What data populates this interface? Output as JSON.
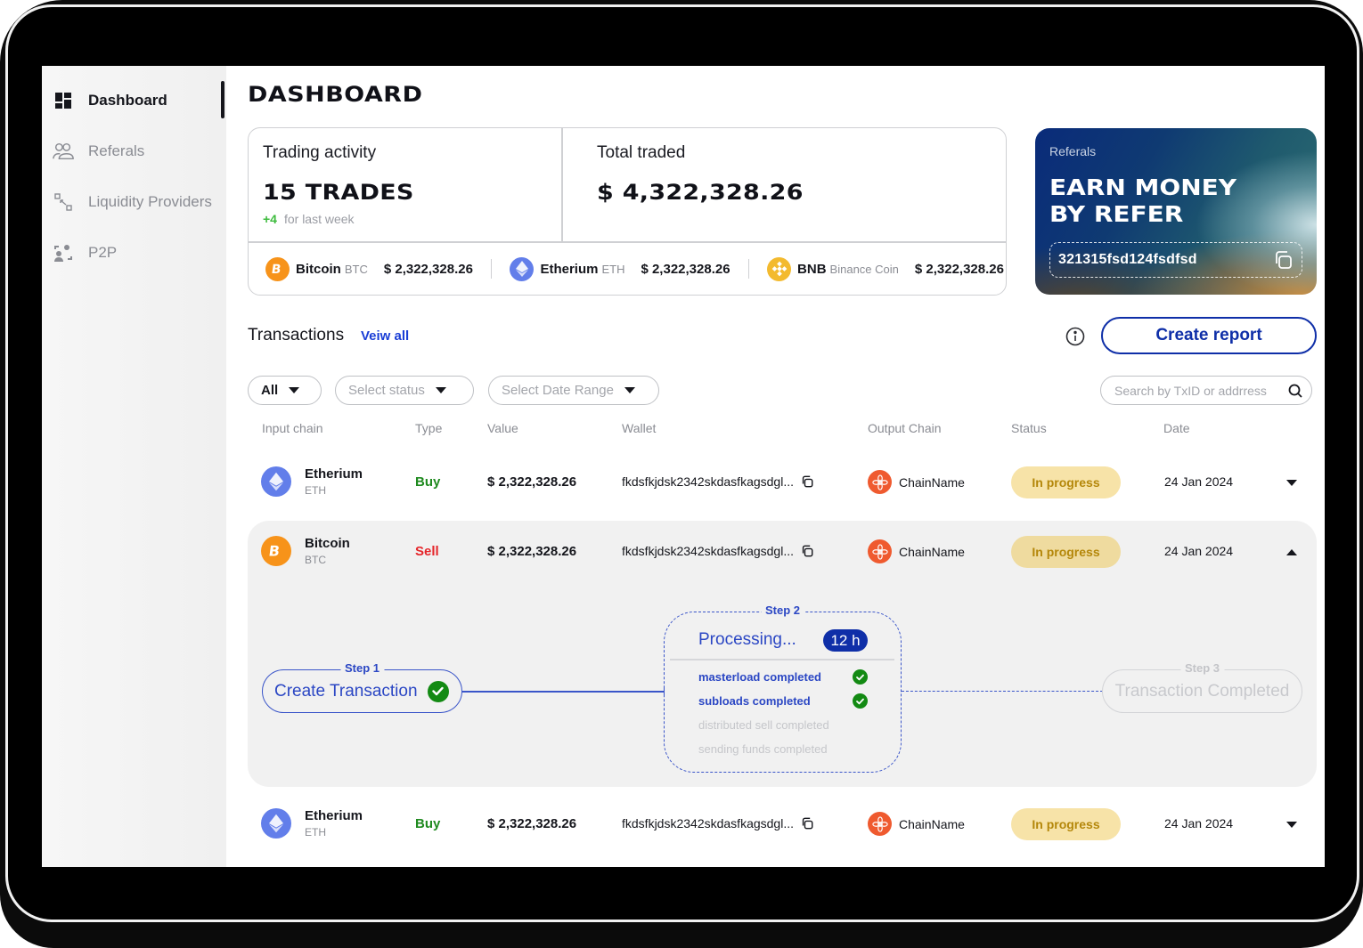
{
  "sidebar": {
    "items": [
      {
        "label": "Dashboard",
        "icon": "dashboard-grid-icon",
        "active": true
      },
      {
        "label": "Referals",
        "icon": "users-icon",
        "active": false
      },
      {
        "label": "Liquidity Providers",
        "icon": "nodes-icon",
        "active": false
      },
      {
        "label": "P2P",
        "icon": "p2p-exchange-icon",
        "active": false
      }
    ]
  },
  "header": {
    "title": "DASHBOARD"
  },
  "stats": {
    "trading_activity": {
      "label": "Trading activity",
      "value": "15 TRADES",
      "delta": "+4",
      "delta_caption": "for last week"
    },
    "total_traded": {
      "label": "Total traded",
      "value": "$ 4,322,328.26"
    },
    "coins": [
      {
        "name": "Bitcoin",
        "ticker": "BTC",
        "value": "$ 2,322,328.26",
        "icon": "bitcoin-icon",
        "color": "#F7931A"
      },
      {
        "name": "Etherium",
        "ticker": "ETH",
        "value": "$ 2,322,328.26",
        "icon": "ethereum-icon",
        "color": "#627EEA"
      },
      {
        "name": "BNB",
        "ticker": "Binance Coin",
        "value": "$ 2,322,328.26",
        "icon": "bnb-icon",
        "color": "#F3BA2F"
      }
    ]
  },
  "referral": {
    "label": "Referals",
    "headline_line1": "EARN MONEY",
    "headline_line2": "BY REFER",
    "code": "321315fsd124fsdfsd"
  },
  "transactions": {
    "title": "Transactions",
    "view_all": "Veiw all",
    "create_report": "Create report",
    "filters": {
      "type": "All",
      "status_placeholder": "Select status",
      "date_placeholder": "Select Date Range"
    },
    "search_placeholder": "Search by TxID or addrress",
    "columns": [
      "Input chain",
      "Type",
      "Value",
      "Wallet",
      "Output Chain",
      "Status",
      "Date"
    ],
    "rows": [
      {
        "chain": "Etherium",
        "ticker": "ETH",
        "type": "Buy",
        "value": "$ 2,322,328.26",
        "wallet": "fkdsfkjdsk2342skdasfkagsdgl...",
        "output_chain": "ChainName",
        "status": "In progress",
        "date": "24 Jan 2024",
        "expanded": false
      },
      {
        "chain": "Bitcoin",
        "ticker": "BTC",
        "type": "Sell",
        "value": "$ 2,322,328.26",
        "wallet": "fkdsfkjdsk2342skdasfkagsdgl...",
        "output_chain": "ChainName",
        "status": "In progress",
        "date": "24 Jan 2024",
        "expanded": true
      },
      {
        "chain": "Etherium",
        "ticker": "ETH",
        "type": "Buy",
        "value": "$ 2,322,328.26",
        "wallet": "fkdsfkjdsk2342skdasfkagsdgl...",
        "output_chain": "ChainName",
        "status": "In progress",
        "date": "24 Jan 2024",
        "expanded": false
      }
    ],
    "progress": {
      "step1": {
        "label": "Step 1",
        "title": "Create Transaction",
        "done": true
      },
      "step2": {
        "label": "Step 2",
        "title": "Processing...",
        "eta": "12 h",
        "substeps": [
          {
            "label": "masterload completed",
            "done": true
          },
          {
            "label": "subloads completed",
            "done": true
          },
          {
            "label": "distributed sell completed",
            "done": false
          },
          {
            "label": "sending funds completed",
            "done": false
          }
        ]
      },
      "step3": {
        "label": "Step 3",
        "title": "Transaction Completed",
        "done": false
      }
    }
  },
  "colors": {
    "accent": "#0F2FA8",
    "buy": "#1F8A1F",
    "sell": "#E5252A",
    "status_in_progress_bg": "#F7E3A8",
    "status_in_progress_text": "#B4870A",
    "success": "#138A13",
    "chain_output": "#EF5A2F"
  }
}
